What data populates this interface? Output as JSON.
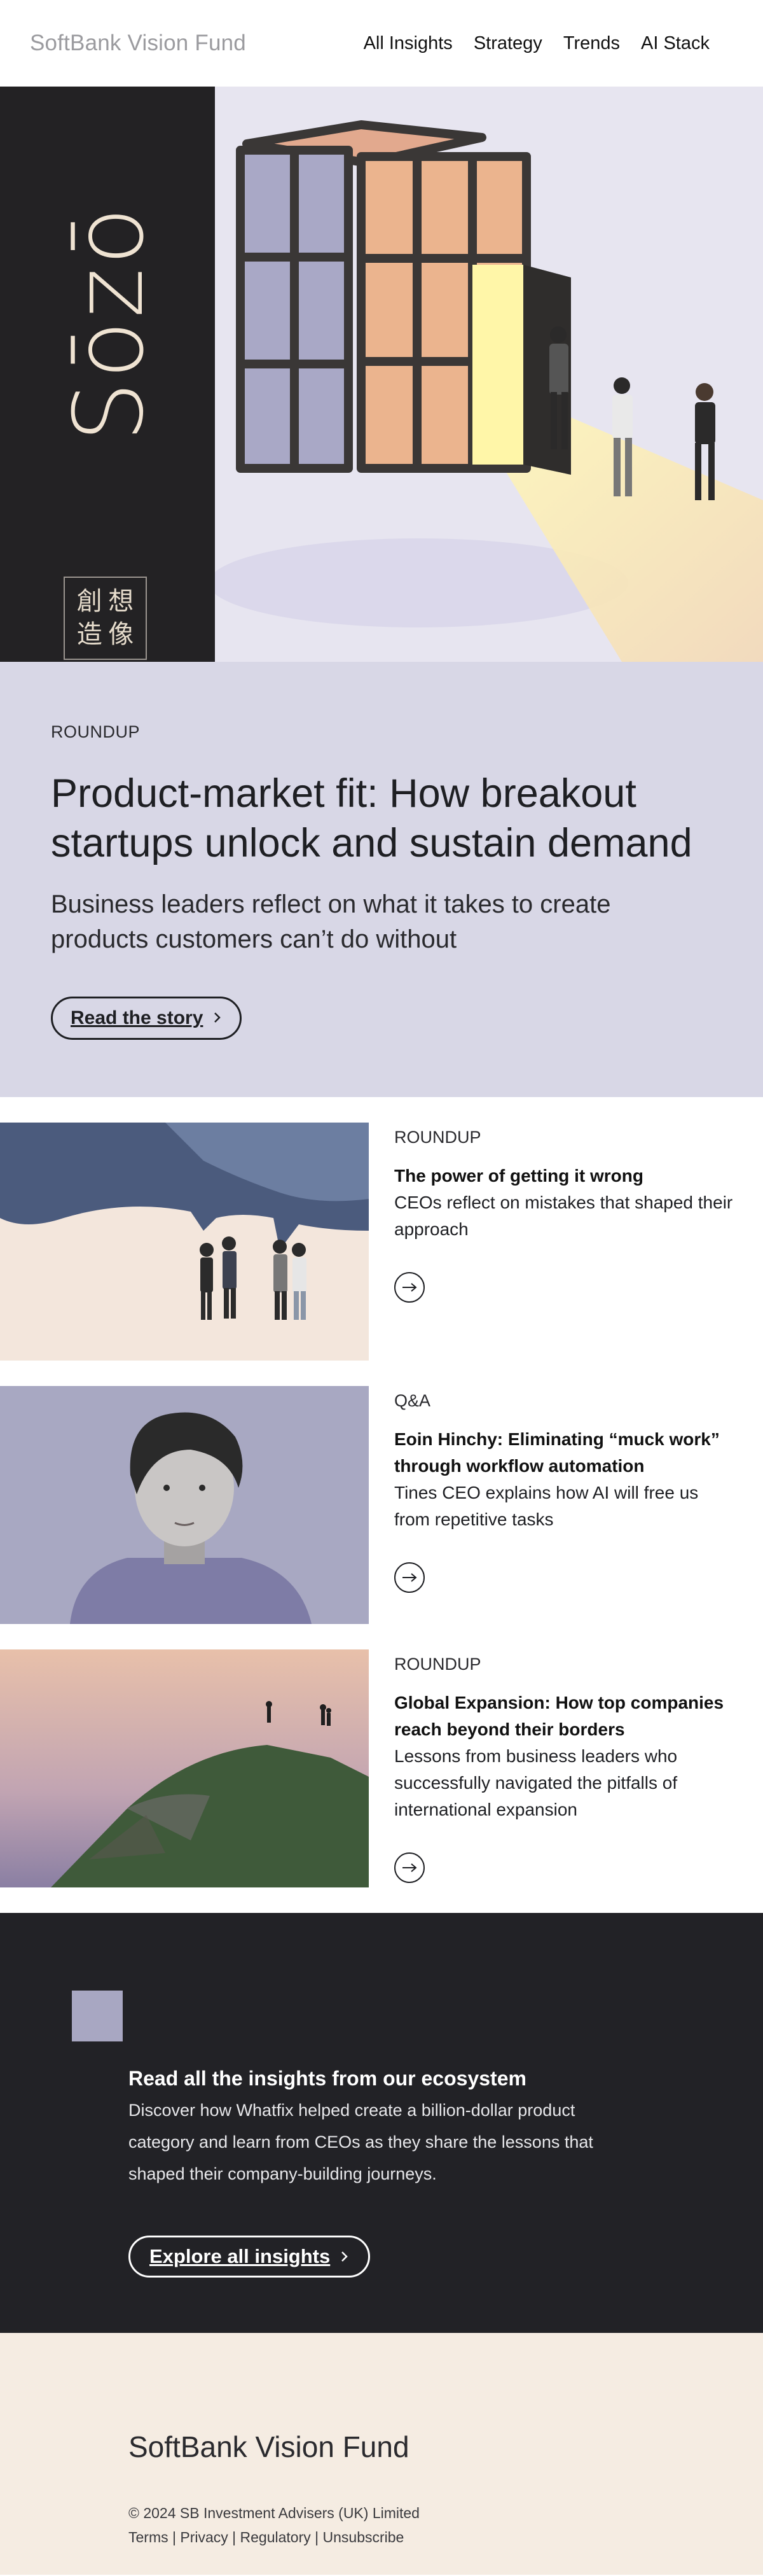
{
  "header": {
    "brand": "SoftBank Vision Fund",
    "nav": [
      "All Insights",
      "Strategy",
      "Trends",
      "AI Stack"
    ]
  },
  "hero": {
    "masthead": "Sōzō",
    "kanji": [
      "創",
      "想",
      "造",
      "像"
    ]
  },
  "feature": {
    "eyebrow": "ROUNDUP",
    "title": "Product-market fit: How breakout startups unlock and sustain demand",
    "subtitle": "Business leaders reflect on what it takes to create products customers can’t do without",
    "cta": "Read the story"
  },
  "cards": [
    {
      "label": "ROUNDUP",
      "title": "The power of getting it wrong",
      "desc": "CEOs reflect on mistakes that shaped their approach"
    },
    {
      "label": "Q&A",
      "title": "Eoin Hinchy: Eliminating “muck work” through workflow automation",
      "desc": "Tines CEO explains how AI will free us from repetitive tasks"
    },
    {
      "label": "ROUNDUP",
      "title": "Global Expansion: How top companies reach beyond their borders",
      "desc": "Lessons from business leaders who successfully navigated the pitfalls of international expansion"
    }
  ],
  "cta_section": {
    "title": "Read all the insights from our ecosystem",
    "body": "Discover how Whatfix helped create a billion-dollar product category and learn from CEOs as they share the lessons that shaped their company-building journeys.",
    "button": "Explore all insights"
  },
  "footer": {
    "brand": "SoftBank Vision Fund",
    "copyright": "© 2024 SB Investment Advisers (UK) Limited",
    "links": "Terms | Privacy | Regulatory | Unsubscribe"
  },
  "colors": {
    "dark": "#222226",
    "lavender": "#d8d7e6",
    "cream": "#f5ece2",
    "peach": "#e9b48f",
    "periwinkle": "#a8a7c2"
  }
}
